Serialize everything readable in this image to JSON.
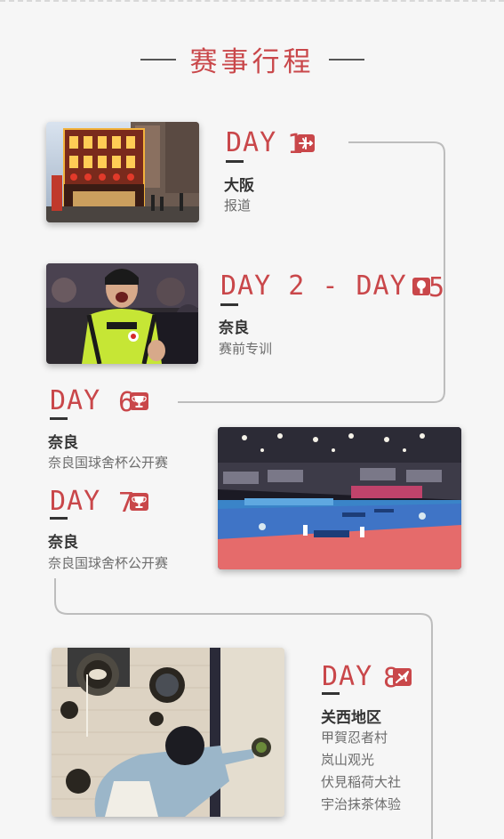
{
  "title": "赛事行程",
  "colors": {
    "accent": "#c9474a",
    "text": "#333333",
    "muted": "#6d6d6d",
    "track": "#bdbdbd"
  },
  "days": [
    {
      "day_label": "DAY",
      "day_number": "1",
      "icon": "airplane-icon",
      "place": "大阪",
      "lines": [
        "报道"
      ]
    },
    {
      "day_label": "DAY 2 - DAY",
      "day_number": "5",
      "icon": "ping-pong-paddle-icon",
      "place": "奈良",
      "lines": [
        "赛前专训"
      ]
    },
    {
      "day_label": "DAY",
      "day_number": "6",
      "icon": "trophy-icon",
      "place": "奈良",
      "lines": [
        "奈良国球舍杯公开赛"
      ]
    },
    {
      "day_label": "DAY",
      "day_number": "7",
      "icon": "trophy-icon",
      "place": "奈良",
      "lines": [
        "奈良国球舍杯公开赛"
      ]
    },
    {
      "day_label": "DAY",
      "day_number": "8",
      "icon": "airplane-icon",
      "place": "关西地区",
      "lines": [
        "甲賀忍者村",
        "岚山观光",
        "伏見稲荷大社",
        "宇治抹茶体验"
      ]
    }
  ]
}
